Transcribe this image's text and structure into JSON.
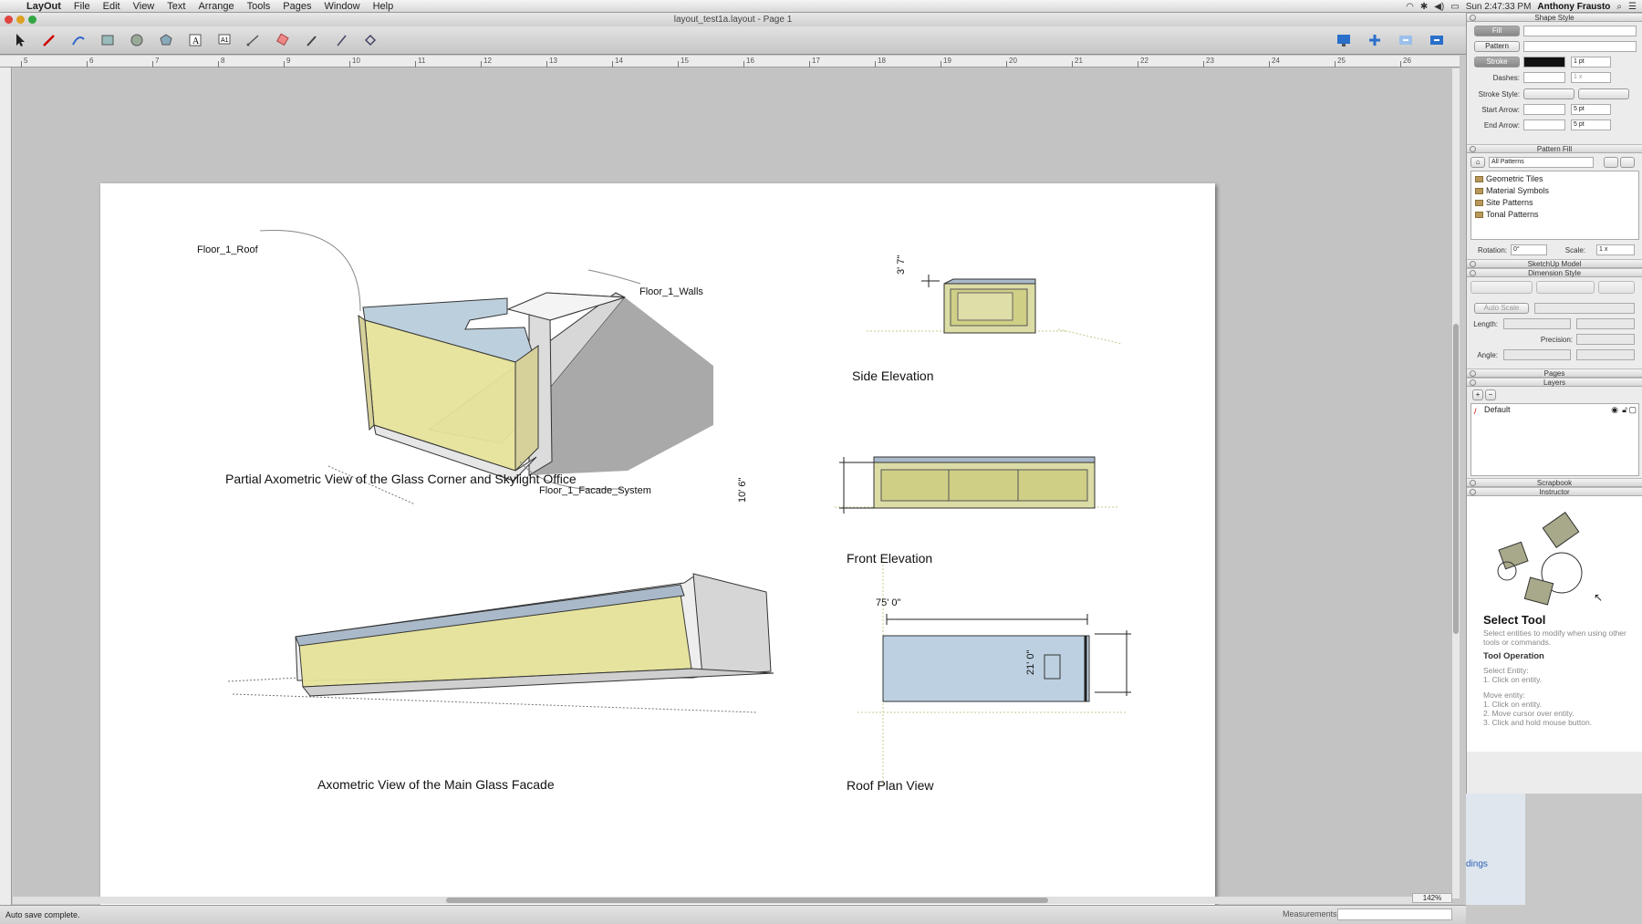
{
  "menubar": {
    "app": "LayOut",
    "items": [
      "File",
      "Edit",
      "View",
      "Text",
      "Arrange",
      "Tools",
      "Pages",
      "Window",
      "Help"
    ],
    "clock": "Sun 2:47:33 PM",
    "user": "Anthony Frausto"
  },
  "window": {
    "title": "layout_test1a.layout - Page 1"
  },
  "ruler": {
    "h_numbers": [
      "5",
      "6",
      "7",
      "8",
      "9",
      "10",
      "11",
      "12",
      "13",
      "14",
      "15",
      "16",
      "17",
      "18",
      "19",
      "20",
      "21",
      "22",
      "23",
      "24",
      "25",
      "26"
    ]
  },
  "page": {
    "captions": {
      "partial_axo": "Partial Axometric View of the Glass Corner and Skylight Office",
      "side_elev": "Side Elevation",
      "front_elev": "Front Elevation",
      "main_axo": "Axometric View of the Main Glass Facade",
      "roof_plan": "Roof Plan View"
    },
    "labels": {
      "roof": "Floor_1_Roof",
      "walls": "Floor_1_Walls",
      "facade": "Floor_1_Facade_System"
    },
    "dims": {
      "side_h": "3' 7\"",
      "front_h": "10' 6\"",
      "roof_w": "75' 0\"",
      "roof_h": "21' 0\""
    }
  },
  "status": {
    "message": "Auto save complete.",
    "measurements_label": "Measurements",
    "zoom": "142%"
  },
  "panel": {
    "shape_style": {
      "title": "Shape Style",
      "fill": "Fill",
      "pattern": "Pattern",
      "stroke": "Stroke",
      "stroke_width": "1 pt",
      "dashes_label": "Dashes:",
      "dash_scale": "1 x",
      "stroke_style_label": "Stroke Style:",
      "start_arrow_label": "Start Arrow:",
      "start_arrow_size": "5 pt",
      "end_arrow_label": "End Arrow:",
      "end_arrow_size": "5 pt"
    },
    "pattern_fill": {
      "title": "Pattern Fill",
      "dropdown": "All Patterns",
      "items": [
        "Geometric Tiles",
        "Material Symbols",
        "Site Patterns",
        "Tonal Patterns"
      ],
      "rotation_label": "Rotation:",
      "rotation": "0°",
      "scale_label": "Scale:",
      "scale": "1 x"
    },
    "sketchup_model": {
      "title": "SketchUp Model"
    },
    "dimension_style": {
      "title": "Dimension Style",
      "auto_scale": "Auto Scale",
      "length_label": "Length:",
      "precision_label": "Precision:",
      "angle_label": "Angle:"
    },
    "pages": {
      "title": "Pages"
    },
    "layers": {
      "title": "Layers",
      "add": "+",
      "remove": "−",
      "items": [
        "Default"
      ]
    },
    "scrapbook": {
      "title": "Scrapbook"
    },
    "instructor": {
      "title": "Instructor",
      "tool_title": "Select Tool",
      "tool_desc": "Select entities to modify when using other tools or commands.",
      "op_title": "Tool Operation",
      "select_head": "Select Entity:",
      "select_1": "1.  Click on entity.",
      "move_head": "Move entity:",
      "move_1": "1.  Click on entity.",
      "move_2": "2.  Move cursor over entity.",
      "move_3": "3.  Click and hold mouse button."
    }
  },
  "background_window": {
    "text": "dings"
  },
  "colors": {
    "glass_yellow": "#e8e49a",
    "roof_blue": "#b9cfe0",
    "wall_gray": "#d6d6d6",
    "shadow": "#a6a6a6"
  }
}
